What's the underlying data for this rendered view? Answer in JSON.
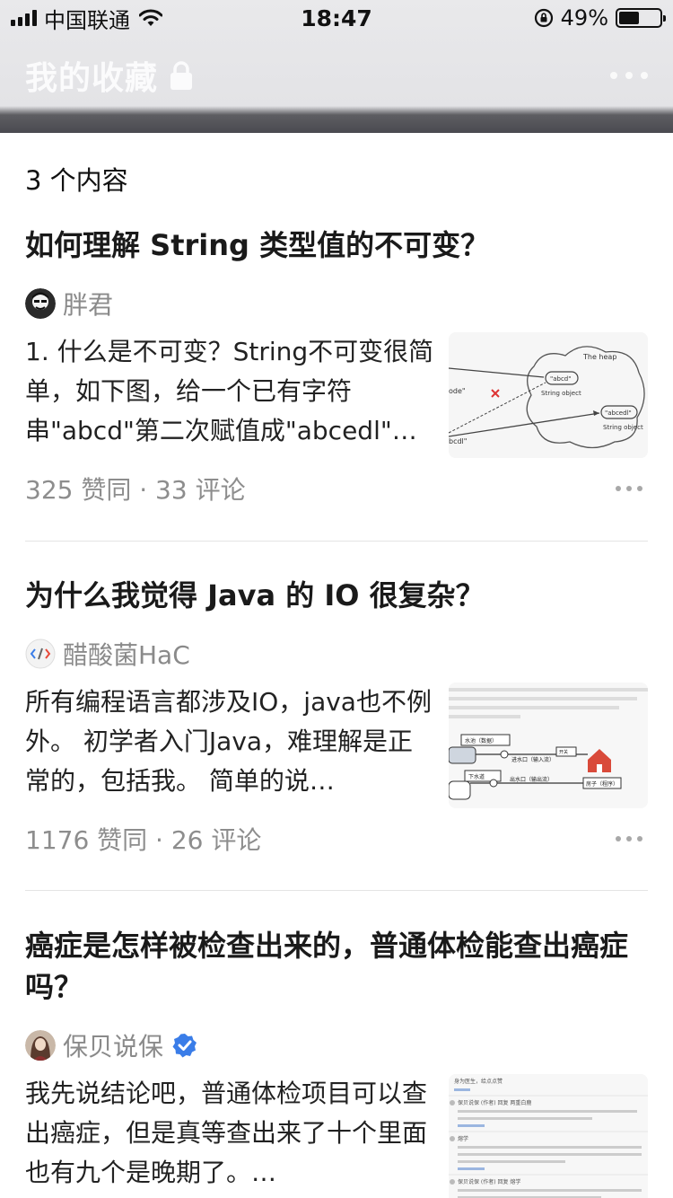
{
  "status": {
    "carrier": "中国联通",
    "time": "18:47",
    "battery": "49%",
    "battery_level": 0.49
  },
  "header": {
    "title": "我的收藏",
    "lock_icon": "lock-icon",
    "more_icon": "more-icon"
  },
  "count_label": "3 个内容",
  "items": [
    {
      "title": "如何理解 String 类型值的不可变？",
      "author": "胖君",
      "excerpt": "1. 什么是不可变？String不可变很简单，如下图，给一个已有字符串\"abcd\"第二次赋值成\"abcedl\"…",
      "stats": "325 赞同 · 33 评论",
      "thumb_labels": {
        "heap": "The heap",
        "box1": "\"abcd\"",
        "obj1": "String object",
        "box2": "\"abcedl\"",
        "obj2": "String object",
        "left1": "ode\"",
        "left2": "bcdl\""
      }
    },
    {
      "title": "为什么我觉得 Java 的 IO 很复杂？",
      "author": "醋酸菌HaC",
      "excerpt": "所有编程语言都涉及IO，java也不例外。 初学者入门Java，难理解是正常的，包括我。 简单的说…",
      "stats": "1176 赞同 · 26 评论",
      "thumb_labels": {
        "a": "水池（数据）",
        "b": "进水口（输入流）",
        "c": "下水道",
        "d": "出水口（输出流）",
        "e": "房子（程序）",
        "f": "开关"
      }
    },
    {
      "title": "癌症是怎样被检查出来的，普通体检能查出癌症吗？",
      "author": "保贝说保",
      "verified": true,
      "excerpt": "我先说结论吧，普通体检项目可以查出癌症，但是真等查出来了十个里面也有九个是晚期了。…",
      "thumb_labels": {
        "a": "身为医生，给点点赞",
        "b": "保贝说保 (作者) 回复 两重白鹿",
        "c": "熔学",
        "d": "保贝说保 (作者) 回复 熔学"
      }
    }
  ],
  "colors": {
    "header_bg": "#e6e6e8",
    "title_white": "#fbfbfc",
    "meta_gray": "#8d8d8d",
    "verified_blue": "#3a7de8"
  }
}
